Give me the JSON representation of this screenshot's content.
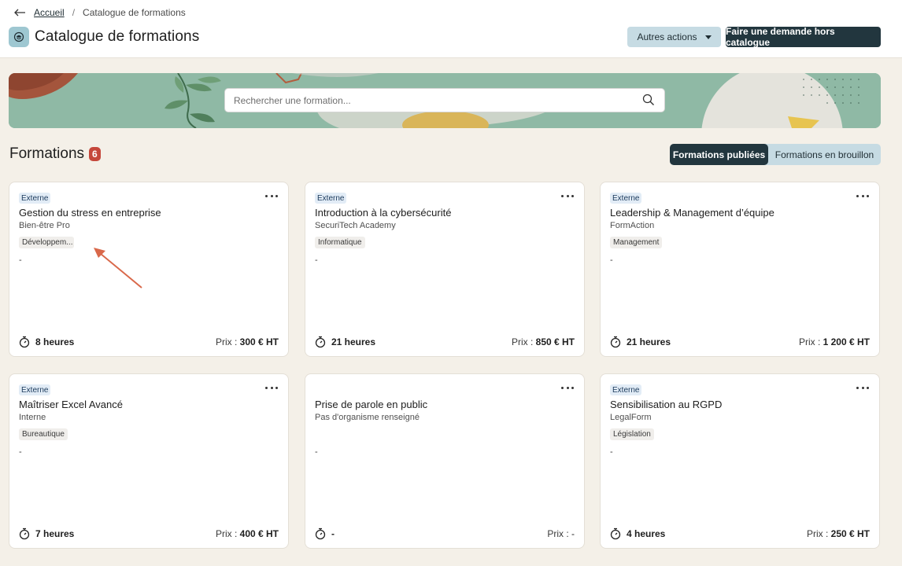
{
  "breadcrumb": {
    "home": "Accueil",
    "separator": "/",
    "current": "Catalogue de formations"
  },
  "header": {
    "title": "Catalogue de formations",
    "more_actions": "Autres actions",
    "request_button": "Faire une demande hors catalogue"
  },
  "search": {
    "placeholder": "Rechercher une formation..."
  },
  "section": {
    "title": "Formations",
    "count": "6",
    "tabs": {
      "published": "Formations publiées",
      "draft": "Formations en brouillon"
    }
  },
  "price_label": "Prix : ",
  "cards": [
    {
      "tag": "Externe",
      "title": "Gestion du stress en entreprise",
      "org": "Bien-être Pro",
      "category": "Développem...",
      "description": "-",
      "duration": "8 heures",
      "price": "300 € HT"
    },
    {
      "tag": "Externe",
      "title": "Introduction à la cybersécurité",
      "org": "SecuriTech Academy",
      "category": "Informatique",
      "description": "-",
      "duration": "21 heures",
      "price": "850 € HT"
    },
    {
      "tag": "Externe",
      "title": "Leadership & Management d’équipe",
      "org": "FormAction",
      "category": "Management",
      "description": "-",
      "duration": "21 heures",
      "price": "1 200 € HT"
    },
    {
      "tag": "Externe",
      "title": "Maîtriser Excel Avancé",
      "org": "Interne",
      "category": "Bureautique",
      "description": "-",
      "duration": "7 heures",
      "price": "400 € HT"
    },
    {
      "tag": "",
      "title": "Prise de parole en public",
      "org": "Pas d'organisme renseigné",
      "category": "",
      "description": "-",
      "duration": "-",
      "price": "-"
    },
    {
      "tag": "Externe",
      "title": "Sensibilisation au RGPD",
      "org": "LegalForm",
      "category": "Législation",
      "description": "-",
      "duration": "4 heures",
      "price": "250 € HT"
    }
  ],
  "colors": {
    "primary": "#22363e",
    "secondary": "#c6dbe3",
    "badge": "#c5473b",
    "background": "#f4f0e8",
    "annotation_arrow": "#d9684a"
  }
}
